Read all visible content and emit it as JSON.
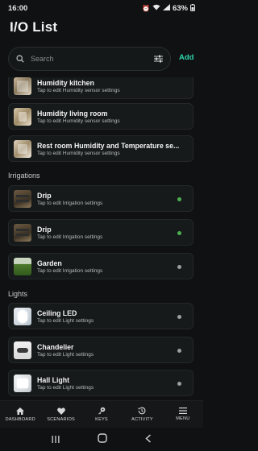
{
  "status": {
    "time": "16:00",
    "battery": "63%"
  },
  "page": {
    "title": "I/O List"
  },
  "search": {
    "placeholder": "Search",
    "add_label": "Add"
  },
  "sections": {
    "irrigations": "Irrigations",
    "lights": "Lights"
  },
  "items": [
    {
      "title": "Humidity kitchen",
      "subtitle": "Tap to edit Humidity sensor settings"
    },
    {
      "title": "Humidity living room",
      "subtitle": "Tap to edit Humidity sensor settings"
    },
    {
      "title": "Rest room Humidity and Temperature se...",
      "subtitle": "Tap to edit Humidity sensor settings"
    },
    {
      "title": "Drip",
      "subtitle": "Tap to edit Irrigation settings",
      "status_color": "#4caf50"
    },
    {
      "title": "Drip",
      "subtitle": "Tap to edit Irrigation settings",
      "status_color": "#4caf50"
    },
    {
      "title": "Garden",
      "subtitle": "Tap to edit Irrigation settings",
      "status_color": "#9e9e9e"
    },
    {
      "title": "Ceiling LED",
      "subtitle": "Tap to edit Light settings",
      "status_color": "#9e9e9e"
    },
    {
      "title": "Chandelier",
      "subtitle": "Tap to edit Light settings",
      "status_color": "#9e9e9e"
    },
    {
      "title": "Hall Light",
      "subtitle": "Tap to edit Light settings",
      "status_color": "#9e9e9e"
    }
  ],
  "nav": [
    {
      "label": "DASHBOARD",
      "icon": "home-icon"
    },
    {
      "label": "SCENARIOS",
      "icon": "heart-icon"
    },
    {
      "label": "KEYS",
      "icon": "key-icon"
    },
    {
      "label": "ACTIVITY",
      "icon": "history-icon"
    },
    {
      "label": "MENU",
      "icon": "menu-icon"
    }
  ],
  "colors": {
    "accent": "#2fd7ad",
    "background": "#0f1112",
    "card": "#171a1b"
  }
}
